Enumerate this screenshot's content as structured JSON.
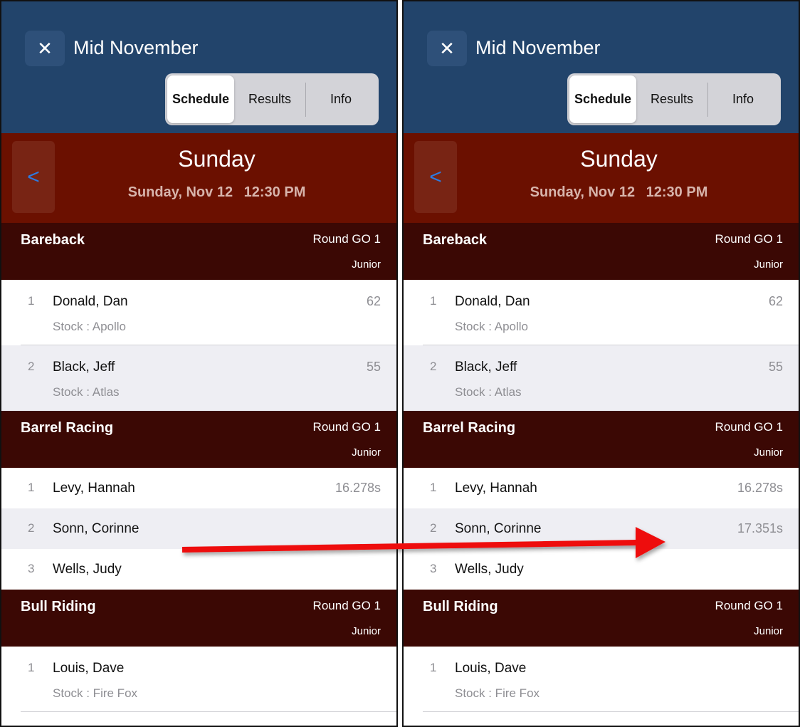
{
  "panels": [
    {
      "header": {
        "close_icon": "✕",
        "title": "Mid November",
        "tabs": {
          "schedule": "Schedule",
          "results": "Results",
          "info": "Info"
        }
      },
      "day": {
        "back_icon": "<",
        "name": "Sunday",
        "date": "Sunday, Nov 12",
        "time": "12:30 PM"
      },
      "events": [
        {
          "name": "Bareback",
          "round": "Round GO 1",
          "division": "Junior",
          "entries": [
            {
              "num": "1",
              "name": "Donald, Dan",
              "stock": "Stock : Apollo",
              "score": "62"
            },
            {
              "num": "2",
              "name": "Black, Jeff",
              "stock": "Stock : Atlas",
              "score": "55"
            }
          ]
        },
        {
          "name": "Barrel Racing",
          "round": "Round GO 1",
          "division": "Junior",
          "entries": [
            {
              "num": "1",
              "name": "Levy, Hannah",
              "score": "16.278s"
            },
            {
              "num": "2",
              "name": "Sonn, Corinne",
              "score": ""
            },
            {
              "num": "3",
              "name": "Wells, Judy",
              "score": ""
            }
          ]
        },
        {
          "name": "Bull Riding",
          "round": "Round GO 1",
          "division": "Junior",
          "entries": [
            {
              "num": "1",
              "name": "Louis, Dave",
              "stock": "Stock : Fire Fox",
              "score": ""
            }
          ]
        }
      ]
    },
    {
      "header": {
        "close_icon": "✕",
        "title": "Mid November",
        "tabs": {
          "schedule": "Schedule",
          "results": "Results",
          "info": "Info"
        }
      },
      "day": {
        "back_icon": "<",
        "name": "Sunday",
        "date": "Sunday, Nov 12",
        "time": "12:30 PM"
      },
      "events": [
        {
          "name": "Bareback",
          "round": "Round GO 1",
          "division": "Junior",
          "entries": [
            {
              "num": "1",
              "name": "Donald, Dan",
              "stock": "Stock : Apollo",
              "score": "62"
            },
            {
              "num": "2",
              "name": "Black, Jeff",
              "stock": "Stock : Atlas",
              "score": "55"
            }
          ]
        },
        {
          "name": "Barrel Racing",
          "round": "Round GO 1",
          "division": "Junior",
          "entries": [
            {
              "num": "1",
              "name": "Levy, Hannah",
              "score": "16.278s"
            },
            {
              "num": "2",
              "name": "Sonn, Corinne",
              "score": "17.351s"
            },
            {
              "num": "3",
              "name": "Wells, Judy",
              "score": ""
            }
          ]
        },
        {
          "name": "Bull Riding",
          "round": "Round GO 1",
          "division": "Junior",
          "entries": [
            {
              "num": "1",
              "name": "Louis, Dave",
              "stock": "Stock : Fire Fox",
              "score": ""
            }
          ]
        }
      ]
    }
  ],
  "annotation": {
    "arrow_color": "#ee1111"
  },
  "colors": {
    "header_blue": "#22446b",
    "day_red": "#6b1000",
    "event_header": "#3b0804",
    "back_arrow_blue": "#2d7be2"
  }
}
